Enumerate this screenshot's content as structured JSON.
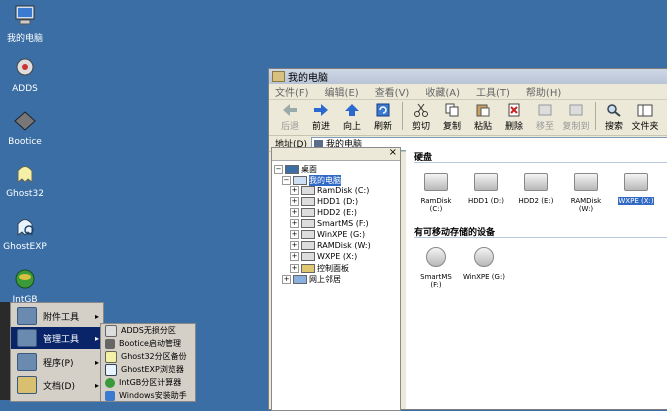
{
  "desktop_icons": [
    {
      "label": "我的电脑",
      "icon": "computer-icon"
    },
    {
      "label": "ADDS",
      "icon": "adds-icon"
    },
    {
      "label": "Bootice",
      "icon": "bootice-icon"
    },
    {
      "label": "Ghost32",
      "icon": "ghost-icon"
    },
    {
      "label": "GhostEXP",
      "icon": "ghostexp-icon"
    },
    {
      "label": "IntGB",
      "icon": "intgb-icon"
    }
  ],
  "window": {
    "title": "我的电脑",
    "menu": [
      "文件(F)",
      "编辑(E)",
      "查看(V)",
      "收藏(A)",
      "工具(T)",
      "帮助(H)"
    ],
    "toolbar": {
      "back": "后退",
      "forward": "前进",
      "up": "向上",
      "refresh": "刷新",
      "cut": "剪切",
      "copy": "复制",
      "paste": "粘贴",
      "delete": "删除",
      "move": "移至",
      "copy_to": "复制到",
      "search": "搜索",
      "folders": "文件夹"
    },
    "address_label": "地址(D)",
    "address_value": "我的电脑"
  },
  "tree": {
    "close": "×",
    "nodes": [
      {
        "label": "桌面",
        "expander": "−"
      },
      {
        "label": "我的电脑",
        "expander": "−"
      },
      {
        "label": "RamDisk (C:)",
        "expander": "+"
      },
      {
        "label": "HDD1 (D:)",
        "expander": "+"
      },
      {
        "label": "HDD2 (E:)",
        "expander": "+"
      },
      {
        "label": "SmartMS (F:)",
        "expander": "+"
      },
      {
        "label": "WinXPE (G:)",
        "expander": "+"
      },
      {
        "label": "RAMDisk (W:)",
        "expander": "+"
      },
      {
        "label": "WXPE (X:)",
        "expander": "+"
      },
      {
        "label": "控制面板",
        "expander": "+"
      },
      {
        "label": "网上邻居",
        "expander": "+"
      }
    ]
  },
  "content": {
    "hard_disks_title": "硬盘",
    "hard_disks": [
      "RamDisk (C:)",
      "HDD1 (D:)",
      "HDD2 (E:)",
      "RAMDisk (W:)",
      "WXPE (X:)"
    ],
    "removable_title": "有可移动存储的设备",
    "removable": [
      "SmartMS (F:)",
      "WinXPE (G:)"
    ]
  },
  "start_menu": {
    "main": [
      {
        "label": "附件工具",
        "arrow": "▸"
      },
      {
        "label": "管理工具",
        "arrow": "▸"
      },
      {
        "label": "程序(P)",
        "arrow": "▸"
      },
      {
        "label": "文档(D)",
        "arrow": "▸"
      }
    ],
    "submenu": [
      "ADDS无损分区",
      "Bootice启动管理",
      "Ghost32分区备份",
      "GhostEXP浏览器",
      "IntGB分区计算器",
      "Windows安装助手"
    ]
  },
  "colors": {
    "desktop": "#3a6ea5",
    "selection": "#316ac5",
    "menu_highlight": "#0a246a"
  }
}
